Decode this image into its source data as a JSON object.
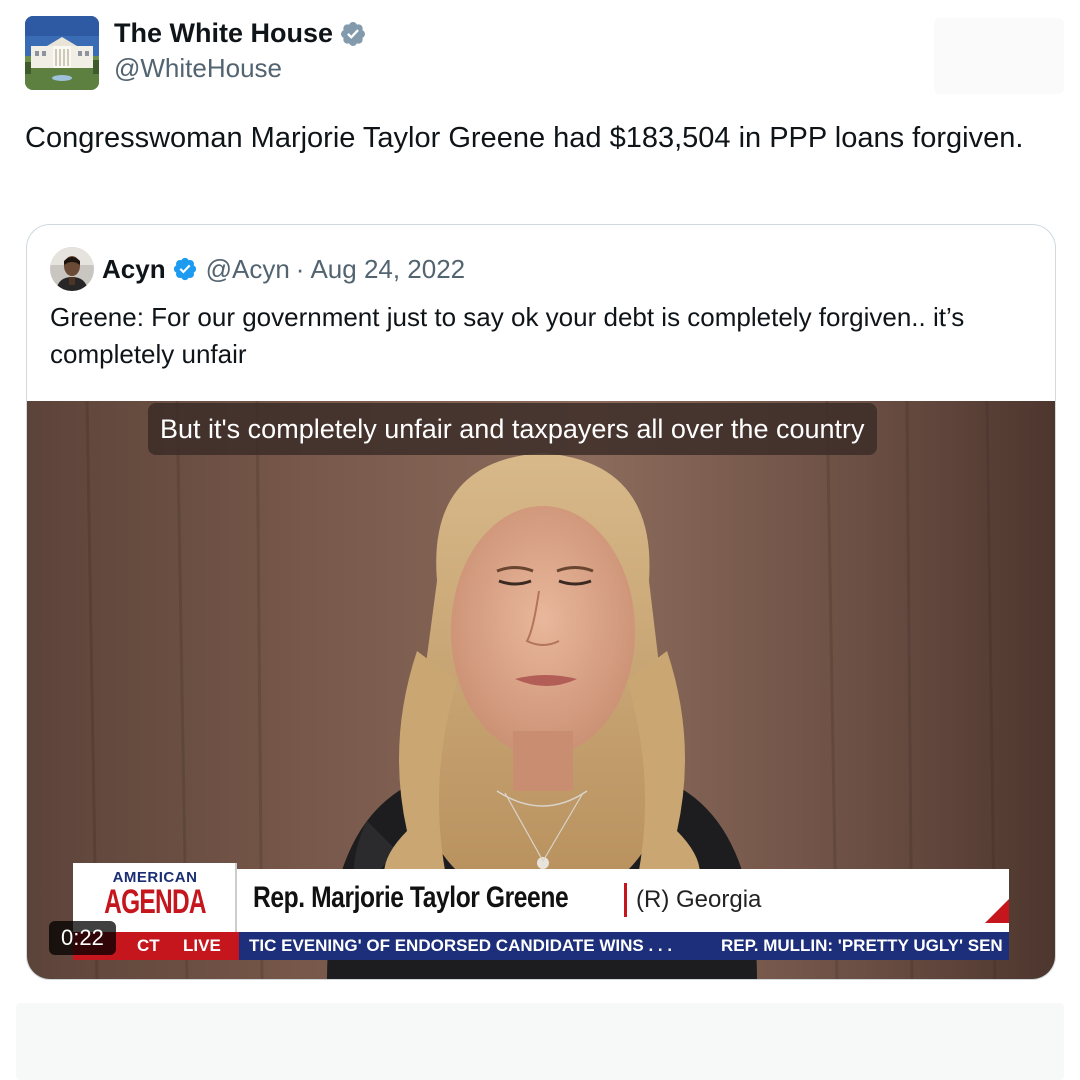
{
  "tweet": {
    "author": {
      "display_name": "The White House",
      "handle": "@WhiteHouse",
      "verified": true
    },
    "text": "Congresswoman Marjorie Taylor Greene had $183,504 in PPP loans forgiven."
  },
  "quoted_tweet": {
    "author": {
      "display_name": "Acyn",
      "handle": "@Acyn",
      "verified": true
    },
    "separator": "·",
    "date": "Aug 24, 2022",
    "text": "Greene: For our government just to say ok your debt is completely forgiven.. it’s completely unfair",
    "video": {
      "caption": "But it's completely unfair and taxpayers all over the country",
      "duration": "0:22",
      "lower_third": {
        "brand_top": "AMERICAN",
        "brand_bottom": "AGENDA",
        "name": "Rep. Marjorie Taylor Greene",
        "party": "(R) Georgia"
      },
      "ticker": {
        "time": "CT",
        "live": "LIVE",
        "headline_1": "TIC EVENING' OF ENDORSED CANDIDATE WINS . . .",
        "headline_2": "REP. MULLIN: 'PRETTY UGLY' SEN"
      }
    }
  },
  "colors": {
    "verified_badge_gray": "#829aab",
    "verified_badge_blue": "#1d9bf0",
    "secondary_text": "#536471",
    "border": "#cfd9de",
    "ticker_blue": "#1d2f7a",
    "brand_red": "#c4161c"
  },
  "icons": [
    "verified-badge-icon"
  ]
}
